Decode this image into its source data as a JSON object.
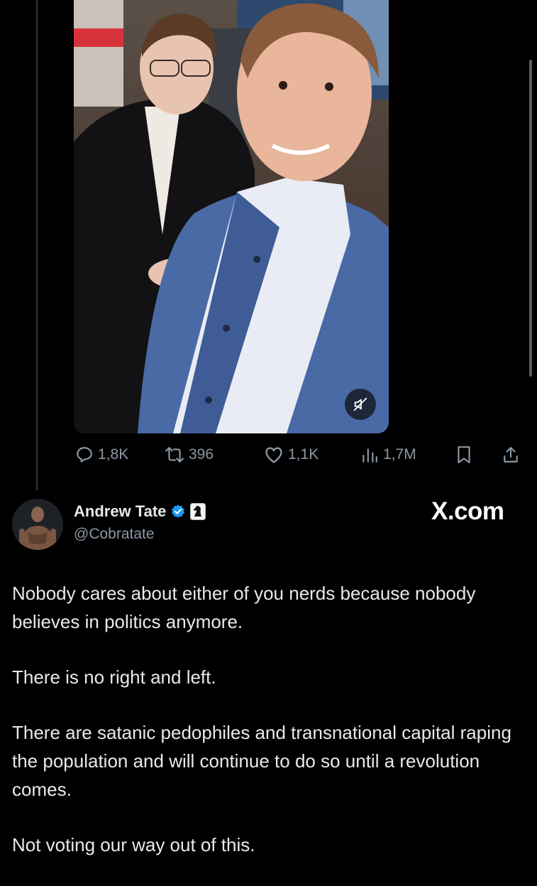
{
  "colors": {
    "background": "#000000",
    "verified": "#1d9bf0",
    "muted_text": "#8b98a5",
    "text": "#e7e9ea"
  },
  "quoted_post": {
    "media_icon": "mute-icon",
    "actions": {
      "replies": "1,8K",
      "reposts": "396",
      "likes": "1,1K",
      "views": "1,7M"
    }
  },
  "post": {
    "display_name": "Andrew Tate",
    "handle": "@Cobratate",
    "watermark": "X.com",
    "badges": [
      "verified-badge-icon",
      "chess-knight-badge-icon"
    ],
    "paragraphs": [
      "Nobody cares about either of you nerds because nobody believes in politics anymore.",
      "There is no right and left.",
      "There are satanic pedophiles and transnational capital raping the population and will continue to do so until a revolution comes.",
      "Not voting our way out of this."
    ]
  }
}
